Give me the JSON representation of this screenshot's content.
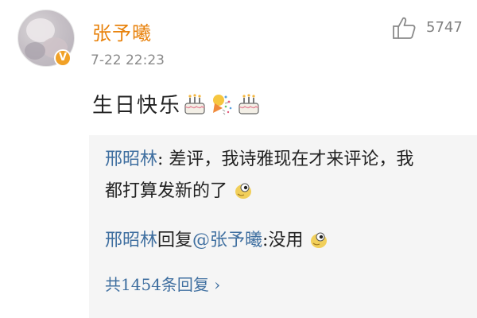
{
  "comment": {
    "username": "张予曦",
    "timestamp": "7-22 22:23",
    "like_count": "5747",
    "text": "生日快乐",
    "emojis": [
      "cake-emoji",
      "party-popper-emoji",
      "cake-emoji"
    ]
  },
  "replies": [
    {
      "author": "邢昭林",
      "separator": ": ",
      "line1": "差评，我诗雅现在才来评论，我",
      "line2": "都打算发新的了",
      "emoji": "doge-emoji"
    },
    {
      "author": "邢昭林",
      "reply_word": "回复",
      "mention": "@张予曦",
      "text": ":没用",
      "emoji": "doge-emoji"
    }
  ],
  "more_replies": "共1454条回复 ›",
  "colors": {
    "username": "#e8820c",
    "link": "#3f6fa0",
    "timestamp": "#8a8a8a",
    "reply_bg": "#f5f5f5"
  }
}
